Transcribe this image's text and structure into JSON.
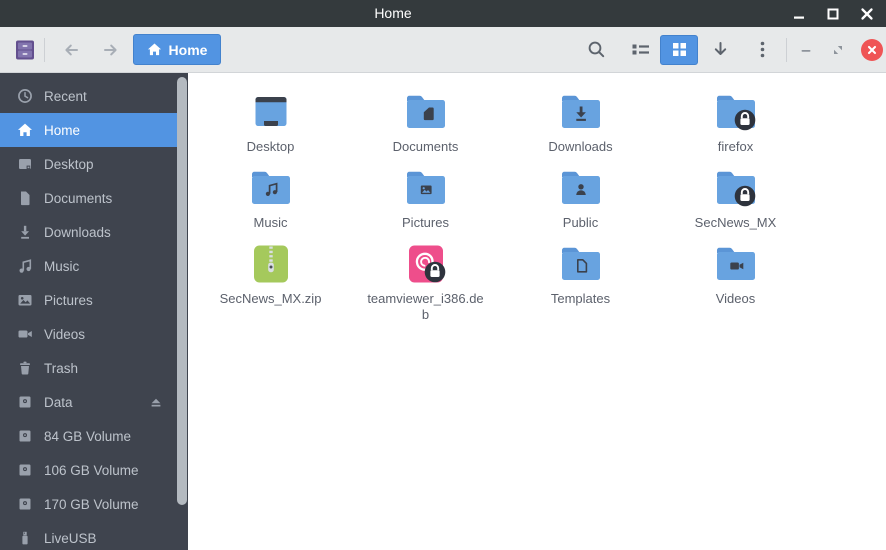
{
  "window": {
    "title": "Home",
    "controls": [
      {
        "name": "minimize"
      },
      {
        "name": "maximize"
      },
      {
        "name": "close"
      }
    ]
  },
  "toolbar": {
    "app_icon": "file-manager",
    "back": "back",
    "forward": "forward",
    "location_button_label": "Home",
    "actions": [
      "search",
      "list-view",
      "grid-view-active",
      "download",
      "menu"
    ],
    "window_actions": [
      "minimize",
      "restore",
      "close"
    ]
  },
  "sidebar": {
    "items": [
      {
        "label": "Recent",
        "icon": "recent",
        "selected": false,
        "eject": false
      },
      {
        "label": "Home",
        "icon": "home",
        "selected": true,
        "eject": false
      },
      {
        "label": "Desktop",
        "icon": "desktop",
        "selected": false,
        "eject": false
      },
      {
        "label": "Documents",
        "icon": "documents",
        "selected": false,
        "eject": false
      },
      {
        "label": "Downloads",
        "icon": "downloads",
        "selected": false,
        "eject": false
      },
      {
        "label": "Music",
        "icon": "music",
        "selected": false,
        "eject": false
      },
      {
        "label": "Pictures",
        "icon": "pictures",
        "selected": false,
        "eject": false
      },
      {
        "label": "Videos",
        "icon": "videos",
        "selected": false,
        "eject": false
      },
      {
        "label": "Trash",
        "icon": "trash",
        "selected": false,
        "eject": false
      },
      {
        "label": "Data",
        "icon": "drive",
        "selected": false,
        "eject": true
      },
      {
        "label": "84 GB Volume",
        "icon": "drive",
        "selected": false,
        "eject": false
      },
      {
        "label": "106 GB Volume",
        "icon": "drive",
        "selected": false,
        "eject": false
      },
      {
        "label": "170 GB Volume",
        "icon": "drive",
        "selected": false,
        "eject": false
      },
      {
        "label": "LiveUSB",
        "icon": "usb",
        "selected": false,
        "eject": false
      }
    ]
  },
  "files": [
    {
      "name": "Desktop",
      "icon": "desktop",
      "emblem": "",
      "lock": false
    },
    {
      "name": "Documents",
      "icon": "folder",
      "emblem": "document",
      "lock": false
    },
    {
      "name": "Downloads",
      "icon": "folder",
      "emblem": "download",
      "lock": false
    },
    {
      "name": "firefox",
      "icon": "folder",
      "emblem": "",
      "lock": true
    },
    {
      "name": "Music",
      "icon": "folder",
      "emblem": "music",
      "lock": false
    },
    {
      "name": "Pictures",
      "icon": "folder",
      "emblem": "picture",
      "lock": false
    },
    {
      "name": "Public",
      "icon": "folder",
      "emblem": "person",
      "lock": false
    },
    {
      "name": "SecNews_MX",
      "icon": "folder",
      "emblem": "",
      "lock": true
    },
    {
      "name": "SecNews_MX.zip",
      "icon": "zip",
      "emblem": "",
      "lock": false
    },
    {
      "name": "teamviewer_i386.deb",
      "icon": "deb",
      "emblem": "",
      "lock": true
    },
    {
      "name": "Templates",
      "icon": "folder",
      "emblem": "template",
      "lock": false
    },
    {
      "name": "Videos",
      "icon": "folder",
      "emblem": "video",
      "lock": false
    }
  ],
  "colors": {
    "accent": "#5294e2",
    "titlebar": "#343a3d",
    "toolbar": "#e7e9ea",
    "sidebar": "#3f444e",
    "folder_body": "#68a3e0",
    "folder_tab": "#5b95d6",
    "emblem_dark": "#3b414c",
    "zip_green": "#a5c95c",
    "deb_pink": "#ee4e8b",
    "close_red": "#ef5455",
    "label_text": "#5c616c"
  }
}
